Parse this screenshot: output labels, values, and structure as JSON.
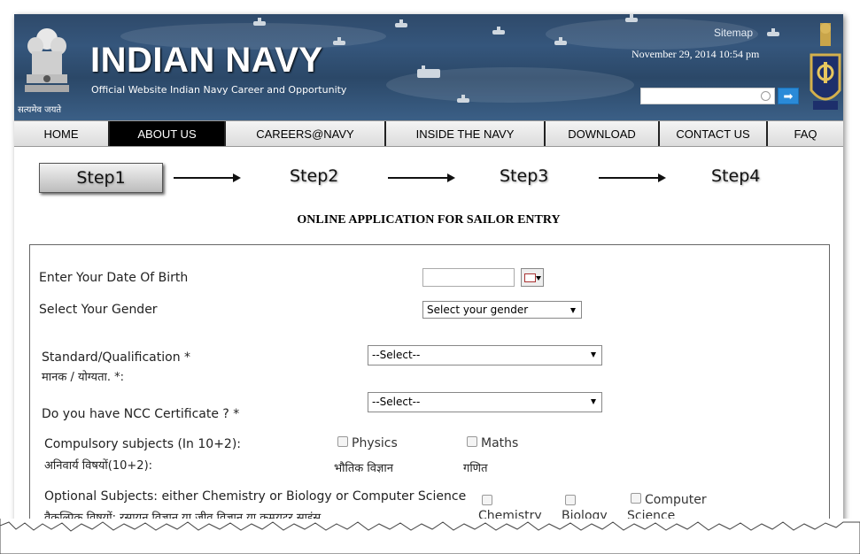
{
  "header": {
    "site_title": "INDIAN NAVY",
    "site_subtitle": "Official Website Indian Navy Career and Opportunity",
    "emblem_caption": "सत्यमेव जयते",
    "sitemap_label": "Sitemap",
    "datetime": "November 29, 2014 10:54 pm",
    "search": {
      "value": "",
      "placeholder": ""
    },
    "search_button_symbol": "➡"
  },
  "nav": {
    "items": [
      "HOME",
      "ABOUT US",
      "CAREERS@NAVY",
      "INSIDE THE NAVY",
      "DOWNLOAD",
      "CONTACT US",
      "FAQ"
    ],
    "active": "ABOUT US"
  },
  "steps": [
    "Step1",
    "Step2",
    "Step3",
    "Step4"
  ],
  "form": {
    "title": "ONLINE APPLICATION FOR SAILOR ENTRY",
    "dob_label": "Enter Your Date Of Birth",
    "dob_value": "",
    "gender_label": "Select Your Gender",
    "gender_select": "Select your gender",
    "qualification_label": "Standard/Qualification *",
    "qualification_hindi": "मानक / योग्यता. *:",
    "qualification_select": "--Select--",
    "ncc_label": "Do you have NCC Certificate ? *",
    "ncc_select": "--Select--",
    "compulsory_label": "Compulsory subjects (In 10+2):",
    "compulsory_hindi": "अनिवार्य विषयों(10+2):",
    "physics_label": "Physics",
    "physics_hindi": "भौतिक विज्ञान",
    "maths_label": "Maths",
    "maths_hindi": "गणित",
    "optional_label": "Optional Subjects: either Chemistry or Biology or Computer Science",
    "optional_hindi": "वैकल्पिक विषयों: रसायन विज्ञान या जीव विज्ञान या कम्प्यूटर साइंस",
    "chemistry_label": "Chemistry",
    "biology_label": "Biology",
    "computer_label_1": "Computer",
    "computer_label_2": "Science"
  }
}
